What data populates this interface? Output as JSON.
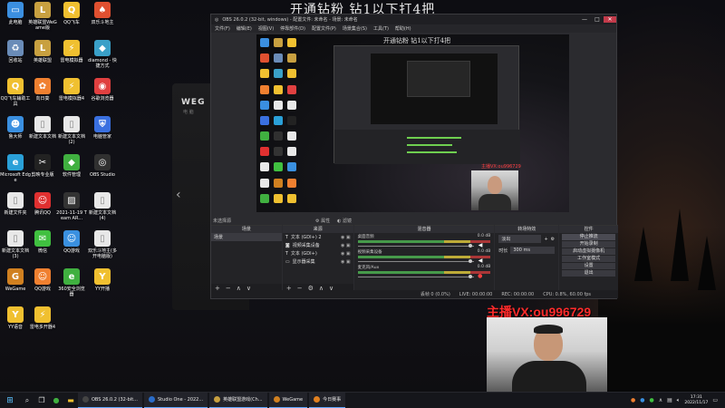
{
  "overlay_title": "开通钻粉 钻1以下打4把",
  "desktop_icons": [
    {
      "label": "此电脑",
      "glyph": "▭",
      "color": "#3b8fe0"
    },
    {
      "label": "英雄联盟WeGame版",
      "glyph": "L",
      "color": "#c8a040"
    },
    {
      "label": "QQ飞车",
      "glyph": "Q",
      "color": "#f0c030"
    },
    {
      "label": "双乐斗地主",
      "glyph": "♠",
      "color": "#e05030"
    },
    {
      "label": "回收站",
      "glyph": "♻",
      "color": "#6a8cb8"
    },
    {
      "label": "英雄联盟",
      "glyph": "L",
      "color": "#c8a040"
    },
    {
      "label": "雷电模拟器",
      "glyph": "⚡",
      "color": "#f0c030"
    },
    {
      "label": "diamond - 快捷方式",
      "glyph": "◆",
      "color": "#3aa0c8"
    },
    {
      "label": "QQ飞车辅助工具",
      "glyph": "Q",
      "color": "#f0c030"
    },
    {
      "label": "向日葵",
      "glyph": "✿",
      "color": "#f08030"
    },
    {
      "label": "雷电模拟器4",
      "glyph": "⚡",
      "color": "#f0c030"
    },
    {
      "label": "谷歌浏览器",
      "glyph": "◉",
      "color": "#e04040"
    },
    {
      "label": "鲁大师",
      "glyph": "☻",
      "color": "#3a8fe0"
    },
    {
      "label": "新建文本文档",
      "glyph": "▯",
      "color": "#e8e8e8"
    },
    {
      "label": "新建文本文档(2)",
      "glyph": "▯",
      "color": "#e8e8e8"
    },
    {
      "label": "电脑管家",
      "glyph": "⛨",
      "color": "#3a70e0"
    },
    {
      "label": "Microsoft Edge",
      "glyph": "e",
      "color": "#2aa0d8"
    },
    {
      "label": "剪映专业版",
      "glyph": "✂",
      "color": "#222222"
    },
    {
      "label": "软件管理",
      "glyph": "◆",
      "color": "#40b040"
    },
    {
      "label": "OBS Studio",
      "glyph": "◎",
      "color": "#303030"
    },
    {
      "label": "新建文件夹",
      "glyph": "▯",
      "color": "#e8e8e8"
    },
    {
      "label": "腾讯QQ",
      "glyph": "☺",
      "color": "#e03030"
    },
    {
      "label": "2021-11-19 Team AR...",
      "glyph": "▨",
      "color": "#333333"
    },
    {
      "label": "新建文本文档(4)",
      "glyph": "▯",
      "color": "#e8e8e8"
    },
    {
      "label": "新建文本文档(3)",
      "glyph": "▯",
      "color": "#e8e8e8"
    },
    {
      "label": "微信",
      "glyph": "✉",
      "color": "#40c040"
    },
    {
      "label": "QQ游戏",
      "glyph": "☺",
      "color": "#3a90e0"
    },
    {
      "label": "双乐斗地主(多开电脑版)",
      "glyph": "▯",
      "color": "#e8e8e8"
    },
    {
      "label": "WeGame",
      "glyph": "G",
      "color": "#d08020"
    },
    {
      "label": "QQ游戏",
      "glyph": "☺",
      "color": "#f08030"
    },
    {
      "label": "360安全浏览器",
      "glyph": "e",
      "color": "#40b040"
    },
    {
      "label": "YY开播",
      "glyph": "Y",
      "color": "#f0c030"
    },
    {
      "label": "YY语音",
      "glyph": "Y",
      "color": "#f0c030"
    },
    {
      "label": "雷电多开器4",
      "glyph": "⚡",
      "color": "#f0c030"
    }
  ],
  "game_window": {
    "logo": "WEG",
    "sub": "电 脑"
  },
  "obs": {
    "title": "OBS 26.0.2 (32-bit, windows) - 配置文件: 未命名 - 场景: 未命名",
    "menus": [
      "文件(F)",
      "编辑(E)",
      "视图(V)",
      "停靠部件(D)",
      "配置文件(P)",
      "场景集合(S)",
      "工具(T)",
      "帮助(H)"
    ],
    "preview_title": "开通钻粉 钻1以下打4把",
    "preview_webcam_text": "主播VX:ou996729",
    "scene_label": "未选择源",
    "preview_ctrls": [
      "属性",
      "滤镜"
    ],
    "docks": {
      "scenes": {
        "header": "场景",
        "items": [
          "场景"
        ]
      },
      "sources": {
        "header": "来源",
        "items": [
          "文本 (GDI+) 2",
          "视频采集设备",
          "文本 (GDI+)",
          "显示器采集"
        ]
      },
      "mixer": {
        "header": "混音器",
        "items": [
          {
            "name": "桌面音频",
            "db": "0.0 dB",
            "muted": false
          },
          {
            "name": "视频采集设备",
            "db": "0.0 dB",
            "muted": false
          },
          {
            "name": "麦克风/Aux",
            "db": "0.0 dB",
            "muted": true
          }
        ]
      },
      "transitions": {
        "header": "转场特效",
        "type": "淡出",
        "duration_label": "时长",
        "duration": "300 ms"
      },
      "controls": {
        "header": "控件",
        "buttons": [
          "停止推流",
          "开始录制",
          "启动虚拟摄像机",
          "工作室模式",
          "设置",
          "退出"
        ]
      }
    },
    "status": {
      "dropped": "丢帧 0 (0.0%)",
      "live": "LIVE: 00:00:00",
      "rec": "REC: 00:00:00",
      "cpu": "CPU: 0.8%, 60.00 fps"
    }
  },
  "cam_caption": "主播VX:ou996729",
  "taskbar": {
    "apps": [
      {
        "label": "OBS 26.0.2 (32-bit...",
        "color": "#444"
      },
      {
        "label": "Studio One - 2022...",
        "color": "#2a6cc8"
      },
      {
        "label": "英雄联盟游戏(Ch...",
        "color": "#c8a040"
      },
      {
        "label": "WeGame",
        "color": "#d08020"
      },
      {
        "label": "今日赛事",
        "color": "#e08020"
      }
    ],
    "time": "17:31",
    "date": "2022/11/17"
  }
}
